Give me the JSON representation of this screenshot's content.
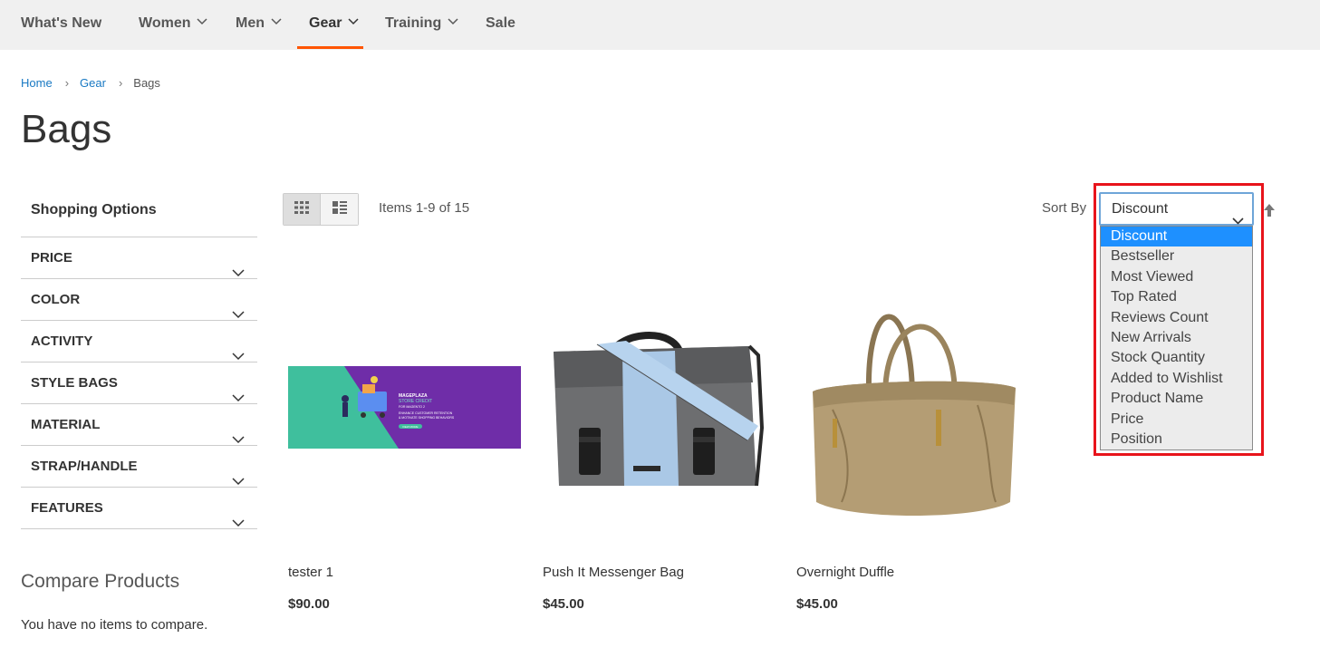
{
  "nav": {
    "items": [
      {
        "label": "What's New"
      },
      {
        "label": "Women"
      },
      {
        "label": "Men"
      },
      {
        "label": "Gear"
      },
      {
        "label": "Training"
      },
      {
        "label": "Sale"
      }
    ]
  },
  "breadcrumb": {
    "home": "Home",
    "gear": "Gear",
    "current": "Bags"
  },
  "page": {
    "title": "Bags"
  },
  "sidebar": {
    "title": "Shopping Options",
    "filters": [
      "PRICE",
      "COLOR",
      "ACTIVITY",
      "STYLE BAGS",
      "MATERIAL",
      "STRAP/HANDLE",
      "FEATURES"
    ]
  },
  "compare": {
    "title": "Compare Products",
    "empty": "You have no items to compare."
  },
  "toolbar": {
    "items_count": "Items 1-9 of 15",
    "sort_label": "Sort By",
    "sort_selected": "Discount",
    "sort_options": [
      "Discount",
      "Bestseller",
      "Most Viewed",
      "Top Rated",
      "Reviews Count",
      "New Arrivals",
      "Stock Quantity",
      "Added to Wishlist",
      "Product Name",
      "Price",
      "Position"
    ]
  },
  "banner": {
    "brand": "MAGEPLAZA",
    "product": "STORE CREDIT",
    "subtitle": "FOR MAGENTO 2",
    "tagline1": "ENHANCE CUSTOMER RETENTION",
    "tagline2": "& MOTIVATE SHOPPING BEHAVIORS",
    "cta": "VIEW MORE"
  },
  "products": [
    {
      "name": "tester 1",
      "price": "$90.00"
    },
    {
      "name": "Push It Messenger Bag",
      "price": "$45.00"
    },
    {
      "name": "Overnight Duffle",
      "price": "$45.00"
    }
  ],
  "colors": {
    "accent": "#ff5501",
    "link": "#1979c3",
    "highlight": "#e8141b",
    "selected_option": "#1e90ff"
  }
}
